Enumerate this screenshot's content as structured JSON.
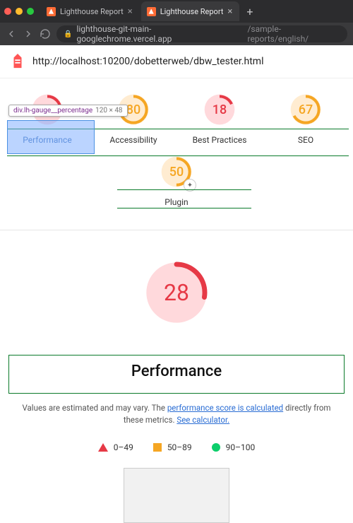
{
  "tabs": [
    {
      "title": "Lighthouse Report"
    },
    {
      "title": "Lighthouse Report"
    }
  ],
  "address": {
    "host": "lighthouse-git-main-googlechrome.vercel.app",
    "path": "/sample-reports/english/"
  },
  "page_url": "http://localhost:10200/dobetterweb/dbw_tester.html",
  "tooltip": {
    "selector": "div.lh-gauge__percentage",
    "dims": "120 × 48"
  },
  "gauges": [
    {
      "score": "28",
      "label": "Performance",
      "tone": "fail"
    },
    {
      "score": "80",
      "label": "Accessibility",
      "tone": "avg"
    },
    {
      "score": "18",
      "label": "Best Practices",
      "tone": "fail"
    },
    {
      "score": "67",
      "label": "SEO",
      "tone": "avg"
    }
  ],
  "plugin": {
    "score": "50",
    "label": "Plugin",
    "tone": "avg"
  },
  "big": {
    "score": "28",
    "label": "Performance"
  },
  "desc": {
    "pre": "Values are estimated and may vary. The ",
    "link1": "performance score is calculated",
    "mid": " directly from these metrics. ",
    "link2": "See calculator."
  },
  "legend": {
    "fail": "0–49",
    "avg": "50–89",
    "pass": "90–100"
  }
}
